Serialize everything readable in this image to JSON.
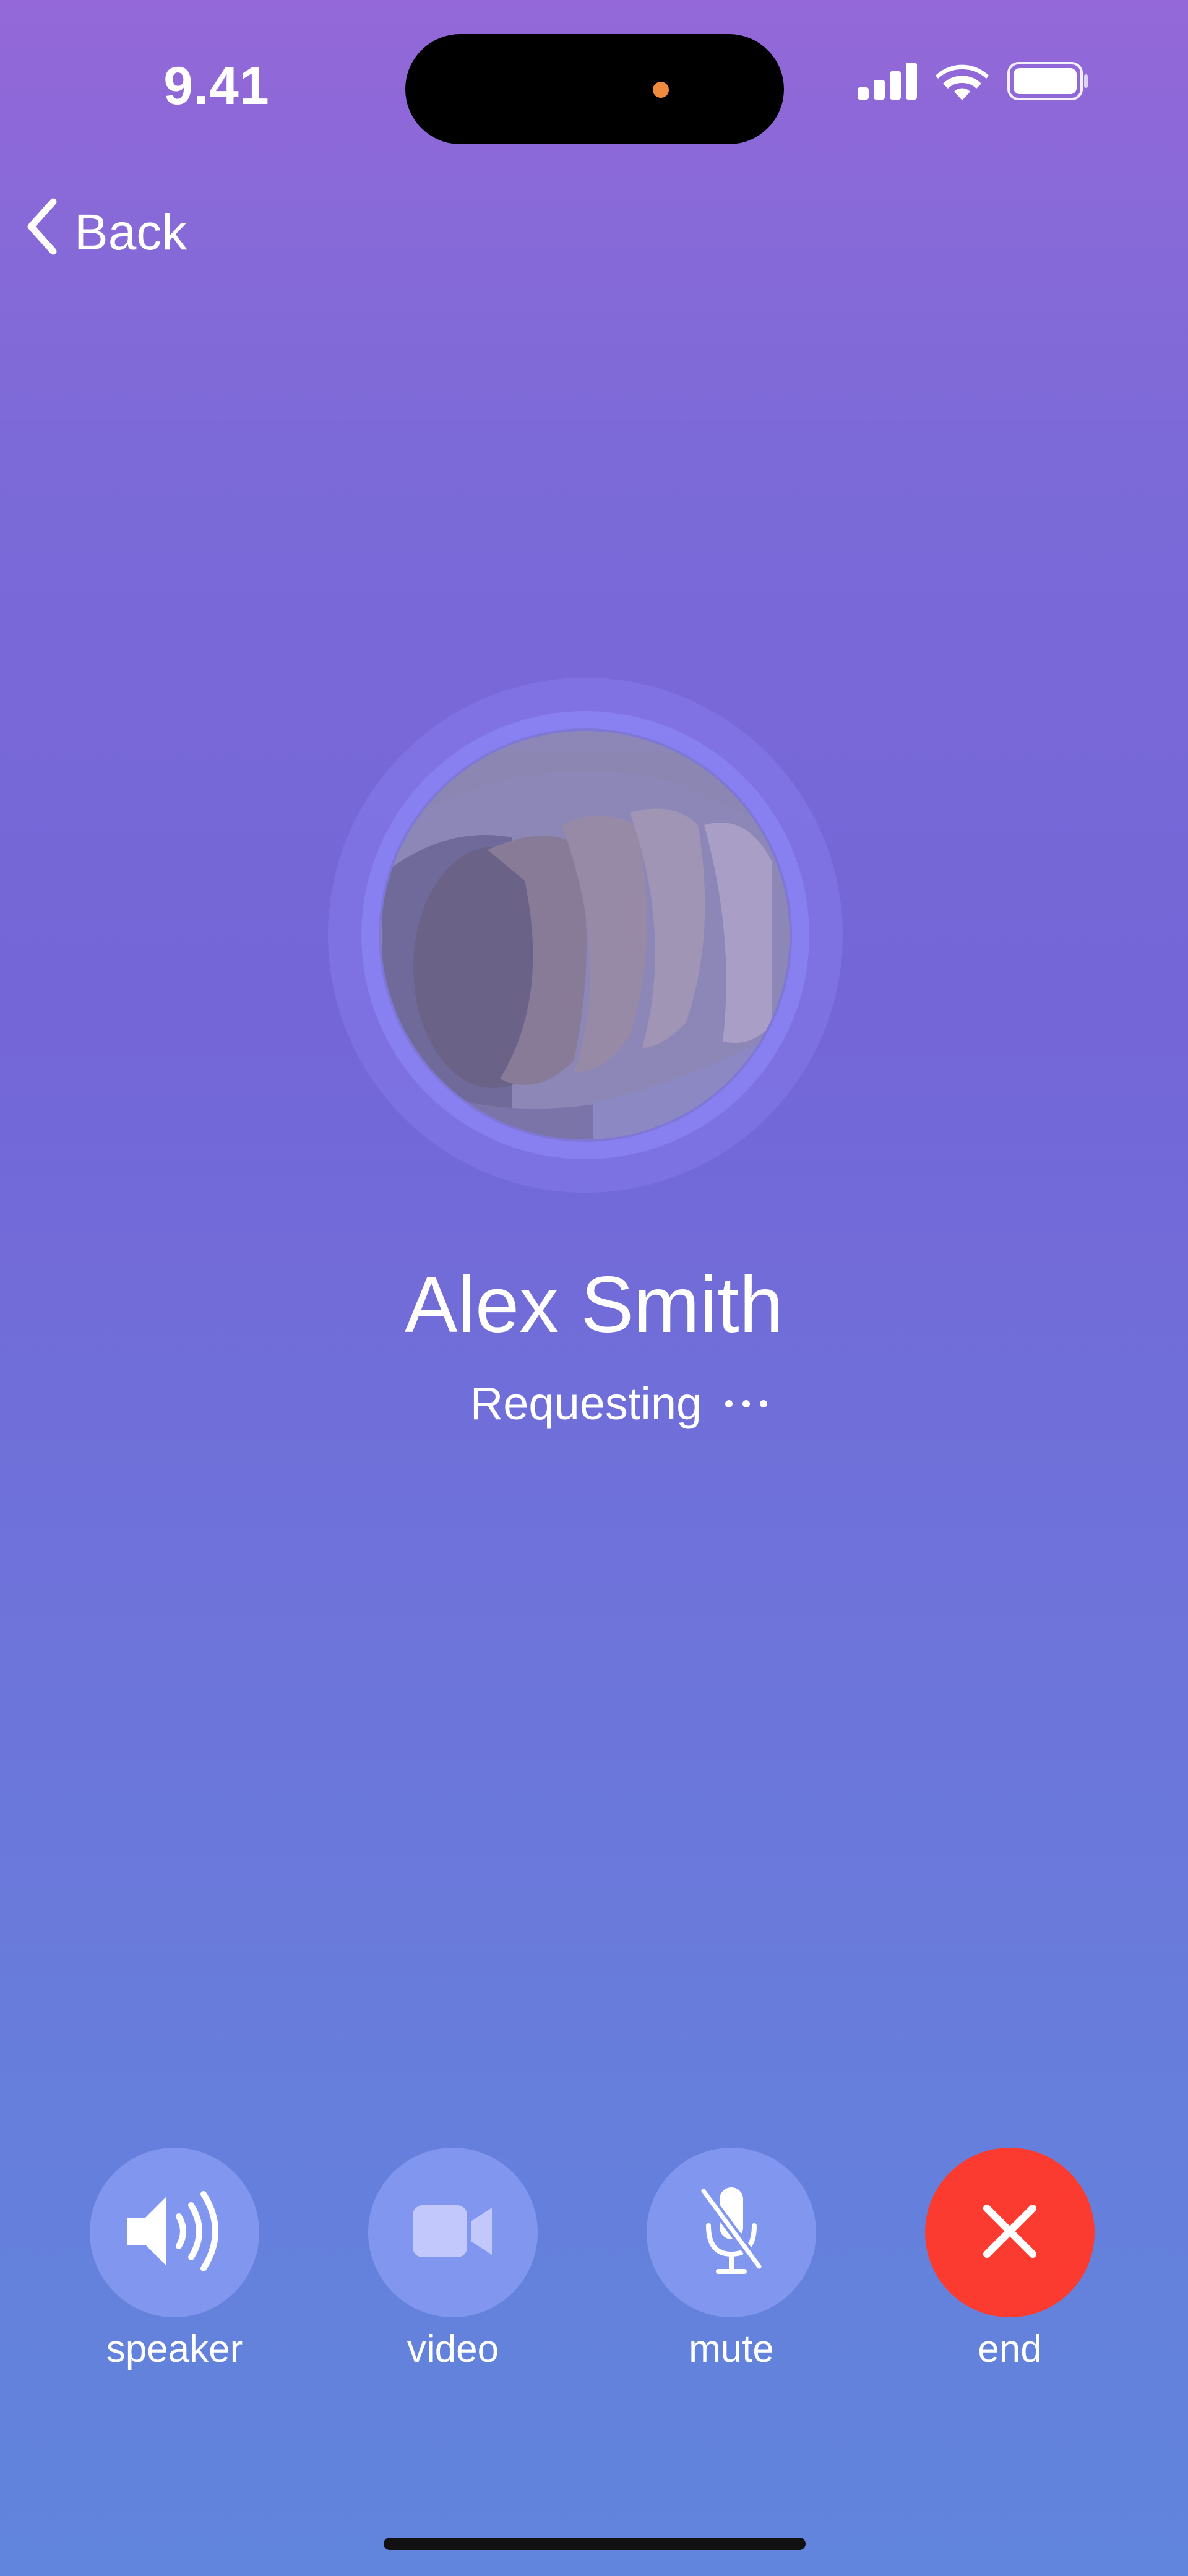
{
  "status_bar": {
    "time": "9.41",
    "icons": [
      "cellular-signal-icon",
      "wifi-icon",
      "battery-icon"
    ]
  },
  "nav": {
    "back_label": "Back"
  },
  "caller": {
    "name": "Alex Smith",
    "status": "Requesting"
  },
  "controls": [
    {
      "label": "speaker",
      "icon": "speaker-icon"
    },
    {
      "label": "video",
      "icon": "video-camera-icon"
    },
    {
      "label": "mute",
      "icon": "microphone-muted-icon"
    },
    {
      "label": "end",
      "icon": "close-icon"
    }
  ],
  "colors": {
    "background_top": "#9468d8",
    "background_bottom": "#6184dc",
    "control_button": "#8197ef",
    "end_button": "#fb3b30",
    "island_dot": "#f08a3c"
  }
}
